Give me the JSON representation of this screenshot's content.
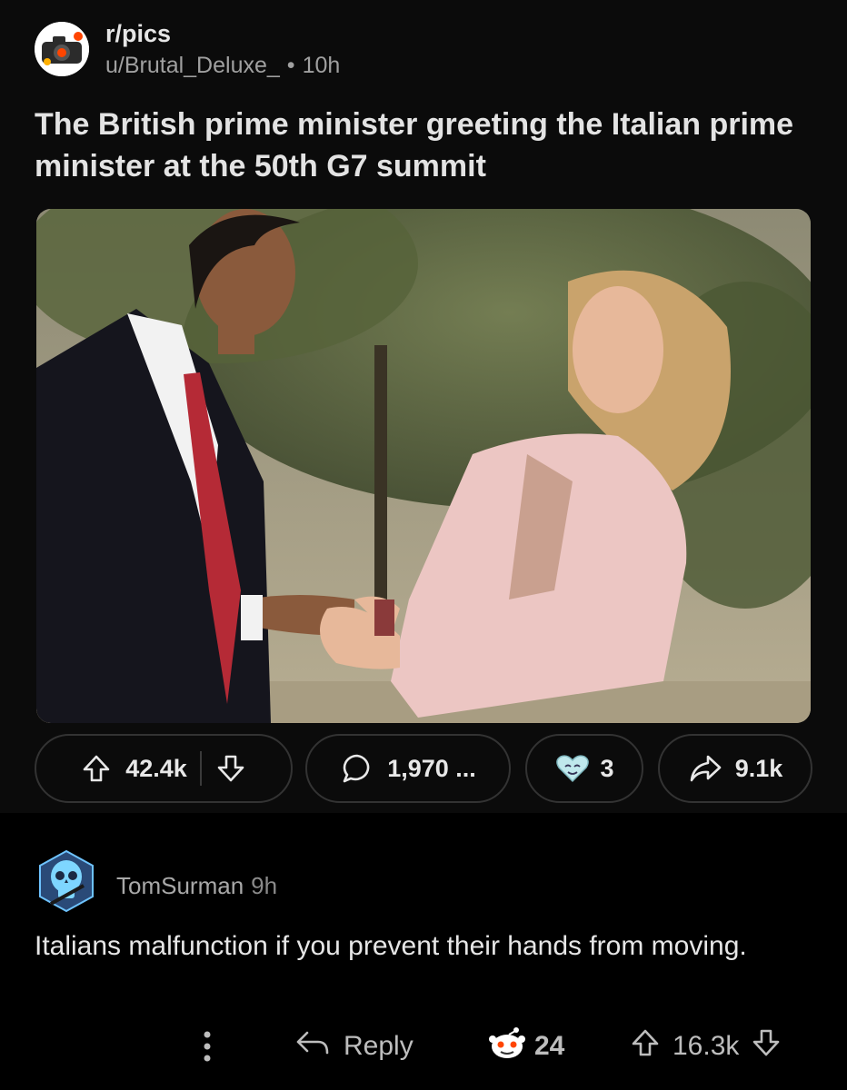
{
  "post": {
    "subreddit": "r/pics",
    "author": "u/Brutal_Deluxe_",
    "separator": "•",
    "age": "10h",
    "title": "The British prime minister greeting the Italian prime minister at the 50th G7 summit",
    "actions": {
      "upvotes": "42.4k",
      "comments": "1,970 ...",
      "awards": "3",
      "shares": "9.1k"
    }
  },
  "comment": {
    "author": "TomSurman",
    "age": "9h",
    "body": "Italians malfunction if you prevent their hands from moving.",
    "reply_label": "Reply",
    "award_count": "24",
    "score": "16.3k"
  },
  "colors": {
    "post_background": "#0b0b0b",
    "page_background": "#000000",
    "pill_border": "#333333",
    "text_primary": "#e6e6e6",
    "text_secondary": "#a0a0a0"
  },
  "icons": [
    "subreddit-avatar-icon",
    "upvote-icon",
    "downvote-icon",
    "comment-bubble-icon",
    "award-heart-icon",
    "share-arrow-icon",
    "skull-avatar-icon",
    "more-options-icon",
    "reply-arrow-icon",
    "award-snoo-icon"
  ]
}
